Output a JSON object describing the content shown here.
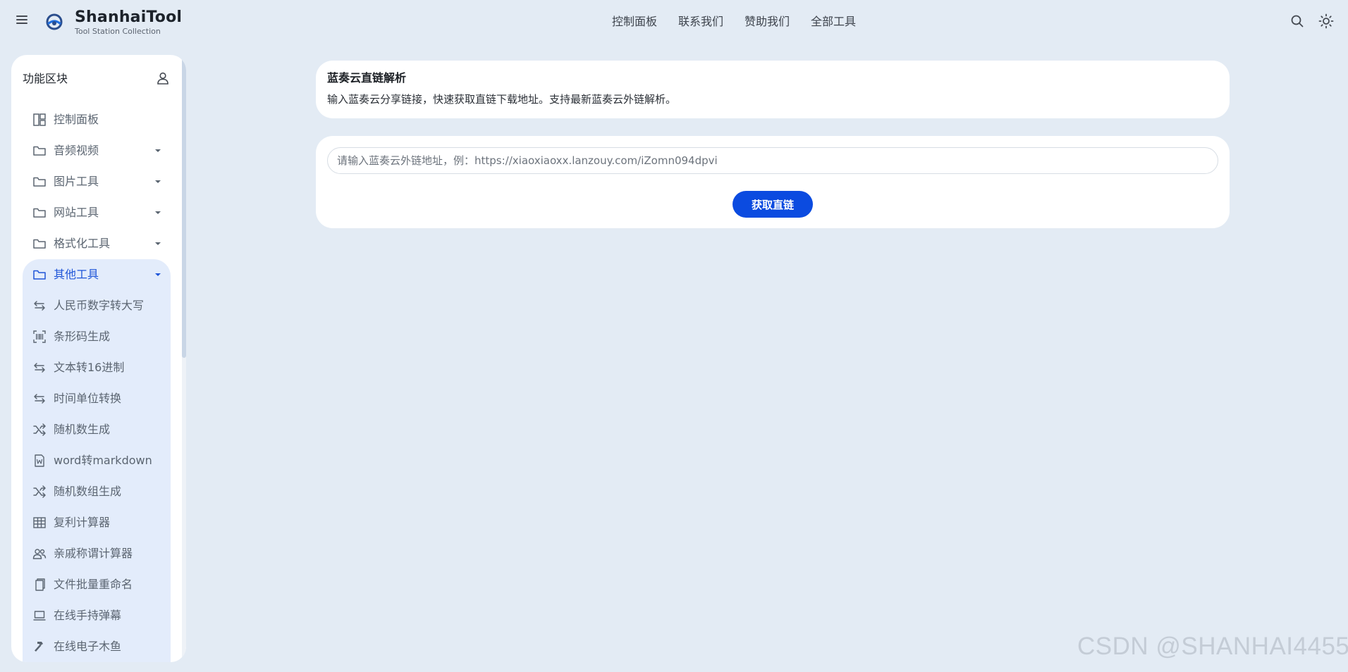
{
  "header": {
    "brand_title": "ShanhaiTool",
    "brand_subtitle": "Tool Station Collection",
    "nav": [
      "控制面板",
      "联系我们",
      "赞助我们",
      "全部工具"
    ]
  },
  "sidebar": {
    "title": "功能区块",
    "items": [
      {
        "label": "控制面板",
        "icon": "dashboard-icon",
        "caret": false
      },
      {
        "label": "音频视频",
        "icon": "folder-icon",
        "caret": true
      },
      {
        "label": "图片工具",
        "icon": "folder-icon",
        "caret": true
      },
      {
        "label": "网站工具",
        "icon": "folder-icon",
        "caret": true
      },
      {
        "label": "格式化工具",
        "icon": "folder-icon",
        "caret": true
      },
      {
        "label": "其他工具",
        "icon": "folder-icon",
        "caret": true,
        "active": true
      }
    ],
    "sub_items": [
      {
        "label": "人民币数字转大写",
        "icon": "swap-icon"
      },
      {
        "label": "条形码生成",
        "icon": "barcode-icon"
      },
      {
        "label": "文本转16进制",
        "icon": "swap-icon"
      },
      {
        "label": "时间单位转换",
        "icon": "swap-icon"
      },
      {
        "label": "随机数生成",
        "icon": "shuffle-icon"
      },
      {
        "label": "word转markdown",
        "icon": "word-file-icon"
      },
      {
        "label": "随机数组生成",
        "icon": "shuffle-icon"
      },
      {
        "label": "复利计算器",
        "icon": "table-icon"
      },
      {
        "label": "亲戚称谓计算器",
        "icon": "people-icon"
      },
      {
        "label": "文件批量重命名",
        "icon": "files-icon"
      },
      {
        "label": "在线手持弹幕",
        "icon": "laptop-icon"
      },
      {
        "label": "在线电子木鱼",
        "icon": "hammer-icon"
      }
    ]
  },
  "main": {
    "title": "蓝奏云直链解析",
    "description": "输入蓝奏云分享链接，快速获取直链下载地址。支持最新蓝奏云外链解析。",
    "input_placeholder": "请输入蓝奏云外链地址，例：https://xiaoxiaoxx.lanzouy.com/iZomn094dpvi",
    "input_value": "",
    "button_label": "获取直链"
  },
  "watermark": "CSDN @SHANHAI4455",
  "colors": {
    "accent": "#0b4be0",
    "background": "#e3ebf4",
    "active_group": "#e3ecfb"
  }
}
